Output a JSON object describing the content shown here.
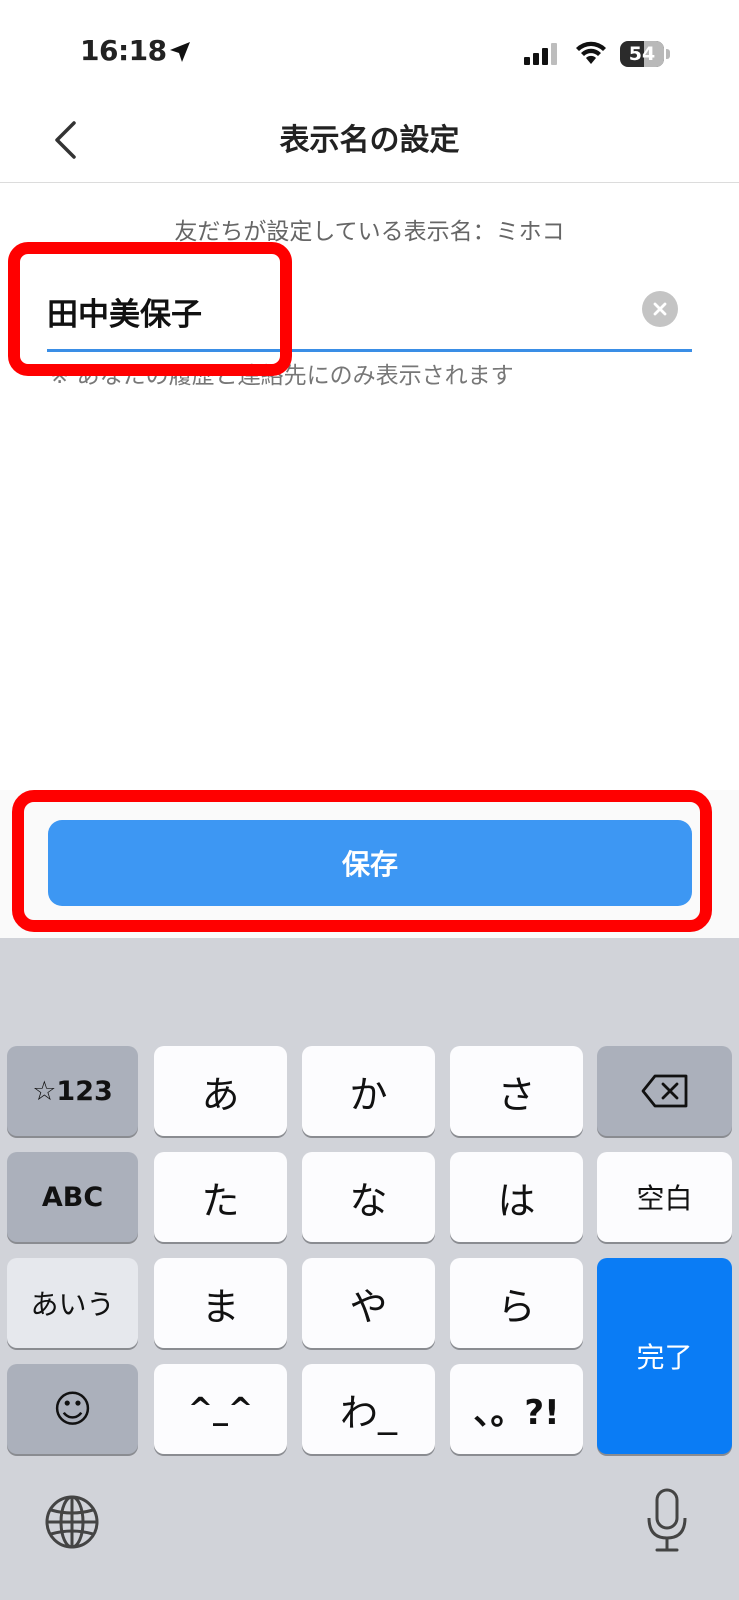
{
  "status_bar": {
    "time": "16:18",
    "battery": "54"
  },
  "nav": {
    "title": "表示名の設定"
  },
  "form": {
    "friend_set_name": "友だちが設定している表示名：ミホコ",
    "name_value": "田中美保子",
    "hint": "※ あなたの履歴と連絡先にのみ表示されます"
  },
  "save_button": {
    "label": "保存"
  },
  "keyboard": {
    "symbols_key": "☆123",
    "abc_key": "ABC",
    "kana_mode_key": "あいう",
    "emoji_key": "☺",
    "row1": [
      "あ",
      "か",
      "さ"
    ],
    "row2": [
      "た",
      "な",
      "は"
    ],
    "row3": [
      "ま",
      "や",
      "ら"
    ],
    "row4": [
      "^_^",
      "わ_",
      "、。?!"
    ],
    "space_key": "空白",
    "done_key": "完了"
  },
  "colors": {
    "accent": "#3d97f3",
    "highlight": "#ff0000",
    "done_key": "#0a7cf5",
    "input_underline": "#3a8ee6"
  }
}
